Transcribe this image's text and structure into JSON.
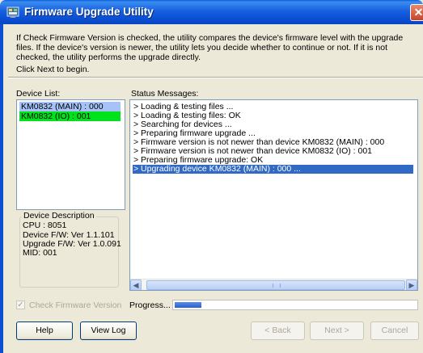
{
  "window": {
    "title": "Firmware Upgrade Utility",
    "close_glyph": "✕",
    "icon": "firmware-utility-icon"
  },
  "info": {
    "text": "If Check Firmware Version is checked, the utility compares the device's firmware level with the upgrade files. If the device's version is newer, the utility lets you decide whether to continue or not. If it is not checked, the utility performs the upgrade directly.",
    "click_next": "Click Next to begin."
  },
  "device_list": {
    "label": "Device List:",
    "items": [
      {
        "label": "KM0832 (MAIN) : 000",
        "state": "selected",
        "bg": "#a6c3f7"
      },
      {
        "label": "KM0832 (IO) : 001",
        "state": "active",
        "bg": "#00e21c"
      }
    ]
  },
  "device_description": {
    "title": "Device Description",
    "lines": [
      "CPU : 8051",
      "Device F/W: Ver 1.1.101",
      "Upgrade F/W: Ver 1.0.091",
      "MID: 001"
    ]
  },
  "status": {
    "label": "Status Messages:",
    "messages": [
      "> Loading & testing files ...",
      "> Loading & testing files: OK",
      "> Searching for devices ...",
      "> Preparing firmware upgrade ...",
      "> Firmware version is not newer than device KM0832 (MAIN) : 000",
      "> Firmware version is not newer than device KM0832 (IO) : 001",
      "> Preparing firmware upgrade: OK",
      "> Upgrading device KM0832 (MAIN) : 000 ..."
    ],
    "selected_index": 7
  },
  "check_firmware": {
    "label": "Check Firmware Version",
    "checked": true,
    "enabled": false
  },
  "progress": {
    "label": "Progress...",
    "value_fraction": 0.11
  },
  "buttons": {
    "help": "Help",
    "view_log": "View Log",
    "back": "< Back",
    "next": "Next >",
    "cancel": "Cancel"
  },
  "colors": {
    "title_bar": "#0a4ed1",
    "selection": "#316ac5",
    "device_active": "#00e21c"
  }
}
